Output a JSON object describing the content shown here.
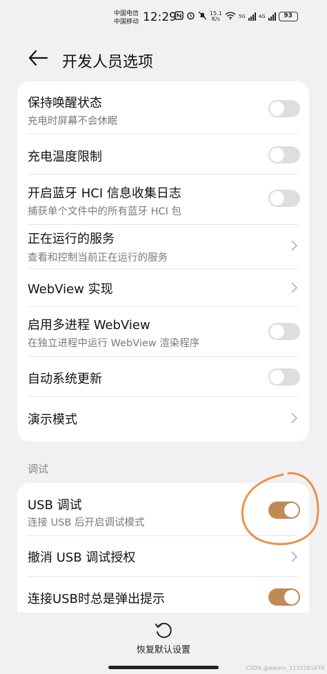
{
  "status_bar": {
    "carrier1": "中国电信",
    "carrier2": "中国移动",
    "time": "12:29",
    "speed_value": "15.1",
    "speed_unit": "K/s",
    "net1": "5G",
    "net2": "4G",
    "battery": "93"
  },
  "header": {
    "title": "开发人员选项"
  },
  "settings": [
    {
      "title": "保持唤醒状态",
      "subtitle": "充电时屏幕不会休眠",
      "control": "toggle",
      "on": false
    },
    {
      "title": "充电温度限制",
      "control": "toggle",
      "on": false
    },
    {
      "title": "开启蓝牙 HCI 信息收集日志",
      "subtitle": "捕获单个文件中的所有蓝牙 HCI 包",
      "control": "toggle",
      "on": false
    },
    {
      "title": "正在运行的服务",
      "subtitle": "查看和控制当前正在运行的服务",
      "control": "chevron"
    },
    {
      "title": "WebView 实现",
      "control": "chevron"
    },
    {
      "title": "启用多进程 WebView",
      "subtitle": "在独立进程中运行 WebView 渲染程序",
      "control": "toggle",
      "on": false
    },
    {
      "title": "自动系统更新",
      "control": "toggle",
      "on": false
    },
    {
      "title": "演示模式",
      "control": "chevron"
    }
  ],
  "debug_section": {
    "label": "调试",
    "items": [
      {
        "title": "USB 调试",
        "subtitle": "连接 USB 后开启调试模式",
        "control": "toggle",
        "on": true
      },
      {
        "title": "撤消 USB 调试授权",
        "control": "chevron"
      },
      {
        "title": "连接USB时总是弹出提示",
        "control": "toggle",
        "on": true
      }
    ]
  },
  "bottom": {
    "reset_label": "恢复默认设置",
    "watermark": "CSDN @weixin_1135581478"
  },
  "colors": {
    "accent": "#c08a55",
    "annotation": "#e8914a",
    "background": "#f1f1f3"
  }
}
